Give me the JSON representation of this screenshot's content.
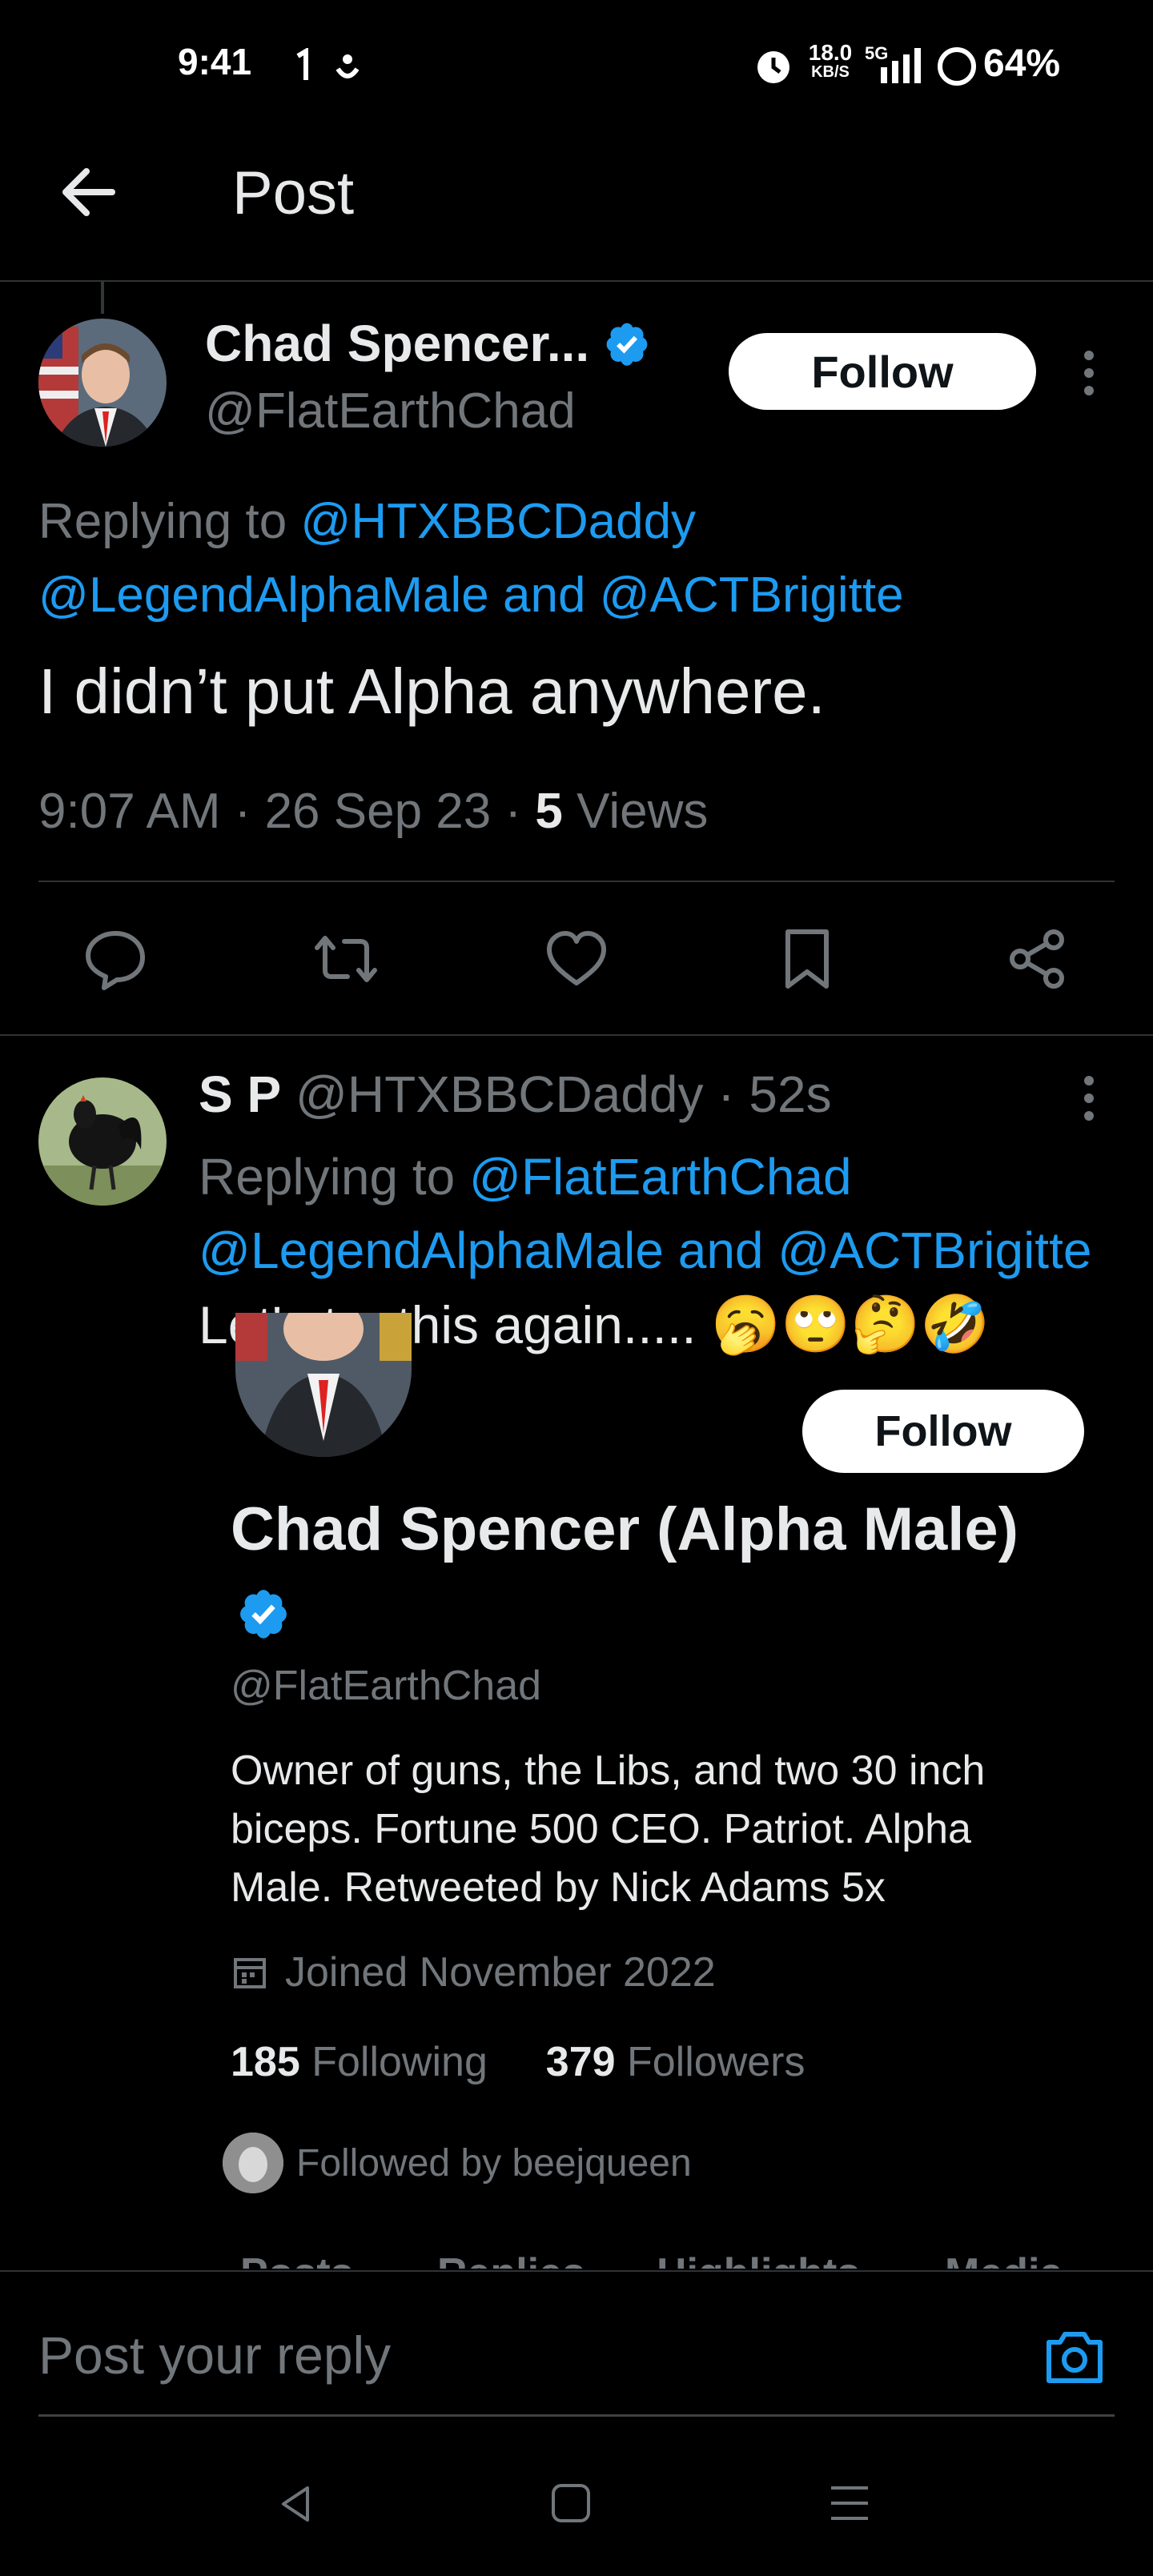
{
  "status_bar": {
    "time": "9:41",
    "net_speed_top": "18.0",
    "net_speed_unit": "KB/S",
    "network": "5G",
    "battery": "64%"
  },
  "header": {
    "title": "Post"
  },
  "main_tweet": {
    "name": "Chad Spencer...",
    "handle": "@FlatEarthChad",
    "follow_label": "Follow",
    "replying_prefix": "Replying to ",
    "replying_to_1": "@HTXBBCDaddy",
    "replying_to_2": "@LegendAlphaMale",
    "replying_and": " and ",
    "replying_to_3": "@ACTBrigitte",
    "text": "I didn’t put Alpha anywhere.",
    "time": "9:07 AM · 26 Sep 23 · ",
    "views_count": "5",
    "views_label": " Views"
  },
  "reply_tweet": {
    "name": "S P",
    "handle": "@HTXBBCDaddy",
    "age": " · 52s",
    "replying_prefix": "Replying to ",
    "replying_to_1": "@FlatEarthChad",
    "replying_to_2": "@LegendAlphaMale",
    "replying_and": " and ",
    "replying_to_3": "@ACTBrigitte",
    "text": "Let's try this again.....",
    "emojis": "🥱🙄🤔🤣"
  },
  "embedded_profile": {
    "follow_label": "Follow",
    "name": "Chad Spencer (Alpha Male)",
    "handle": "@FlatEarthChad",
    "bio": "Owner of guns, the Libs, and two 30 inch biceps. Fortune 500 CEO. Patriot. Alpha Male. Retweeted by Nick Adams 5x",
    "joined": "Joined November 2022",
    "following_count": "185",
    "following_label": " Following",
    "followers_count": "379",
    "followers_label": " Followers",
    "followed_by": "Followed by beejqueen",
    "tabs": [
      "Posts",
      "Replies",
      "Highlights",
      "Media"
    ]
  },
  "reply_bar": {
    "placeholder": "Post your reply"
  },
  "colors": {
    "accent": "#1d9bf0",
    "muted": "#71767b",
    "text": "#e7e9ea",
    "background": "#000000"
  },
  "icons": [
    "back-arrow-icon",
    "verified-badge-icon",
    "more-icon",
    "reply-icon",
    "repost-icon",
    "like-icon",
    "bookmark-icon",
    "share-icon",
    "calendar-icon",
    "camera-icon",
    "nav-back-icon",
    "nav-home-icon",
    "nav-recents-icon"
  ]
}
